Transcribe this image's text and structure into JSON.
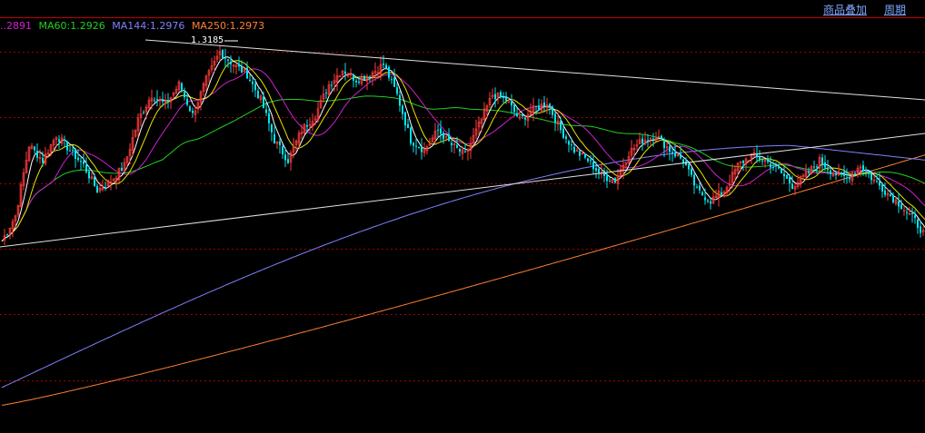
{
  "toolbar": {
    "overlay_label": "商品叠加",
    "period_label": "周期"
  },
  "legend": [
    {
      "text": "..2891",
      "color": "#d020d0"
    },
    {
      "text": "MA60:1.2926",
      "color": "#20d020"
    },
    {
      "text": "MA144:1.2976",
      "color": "#8080ff"
    },
    {
      "text": "MA250:1.2973",
      "color": "#ff8030"
    }
  ],
  "colors": {
    "up": "#ff3b3b",
    "down": "#00e5ee",
    "grid": "#a00000",
    "trend": "#e0e0e0",
    "ma5": "#ffffff",
    "ma10": "#e6e600",
    "ma20": "#d020d0",
    "ma60": "#20d020",
    "ma144": "#8080ff",
    "ma250": "#ff8030"
  },
  "chart_data": {
    "type": "candlestick",
    "peak_label": "1.3185",
    "ylim": [
      1.242,
      1.324
    ],
    "grid_levels": [
      1.3175,
      1.3045,
      1.2915,
      1.2785,
      1.2655,
      1.2525
    ],
    "close_path": [
      1.28,
      1.285,
      1.299,
      1.296,
      1.301,
      1.298,
      1.295,
      1.29,
      1.292,
      1.295,
      1.304,
      1.309,
      1.307,
      1.311,
      1.305,
      1.312,
      1.3175,
      1.315,
      1.313,
      1.308,
      1.3,
      1.296,
      1.302,
      1.305,
      1.311,
      1.314,
      1.312,
      1.313,
      1.315,
      1.309,
      1.3,
      1.298,
      1.302,
      1.299,
      1.297,
      1.303,
      1.309,
      1.308,
      1.304,
      1.306,
      1.3075,
      1.302,
      1.298,
      1.296,
      1.293,
      1.292,
      1.2975,
      1.3,
      1.301,
      1.298,
      1.296,
      1.29,
      1.288,
      1.29,
      1.295,
      1.297,
      1.296,
      1.294,
      1.291,
      1.293,
      1.296,
      1.2935,
      1.2925,
      1.295,
      1.292,
      1.2895,
      1.287,
      1.284,
      1.28
    ],
    "moving_averages": [
      {
        "name": "MA60",
        "value": 1.2926
      },
      {
        "name": "MA144",
        "value": 1.2976
      },
      {
        "name": "MA250",
        "value": 1.2973
      }
    ]
  }
}
